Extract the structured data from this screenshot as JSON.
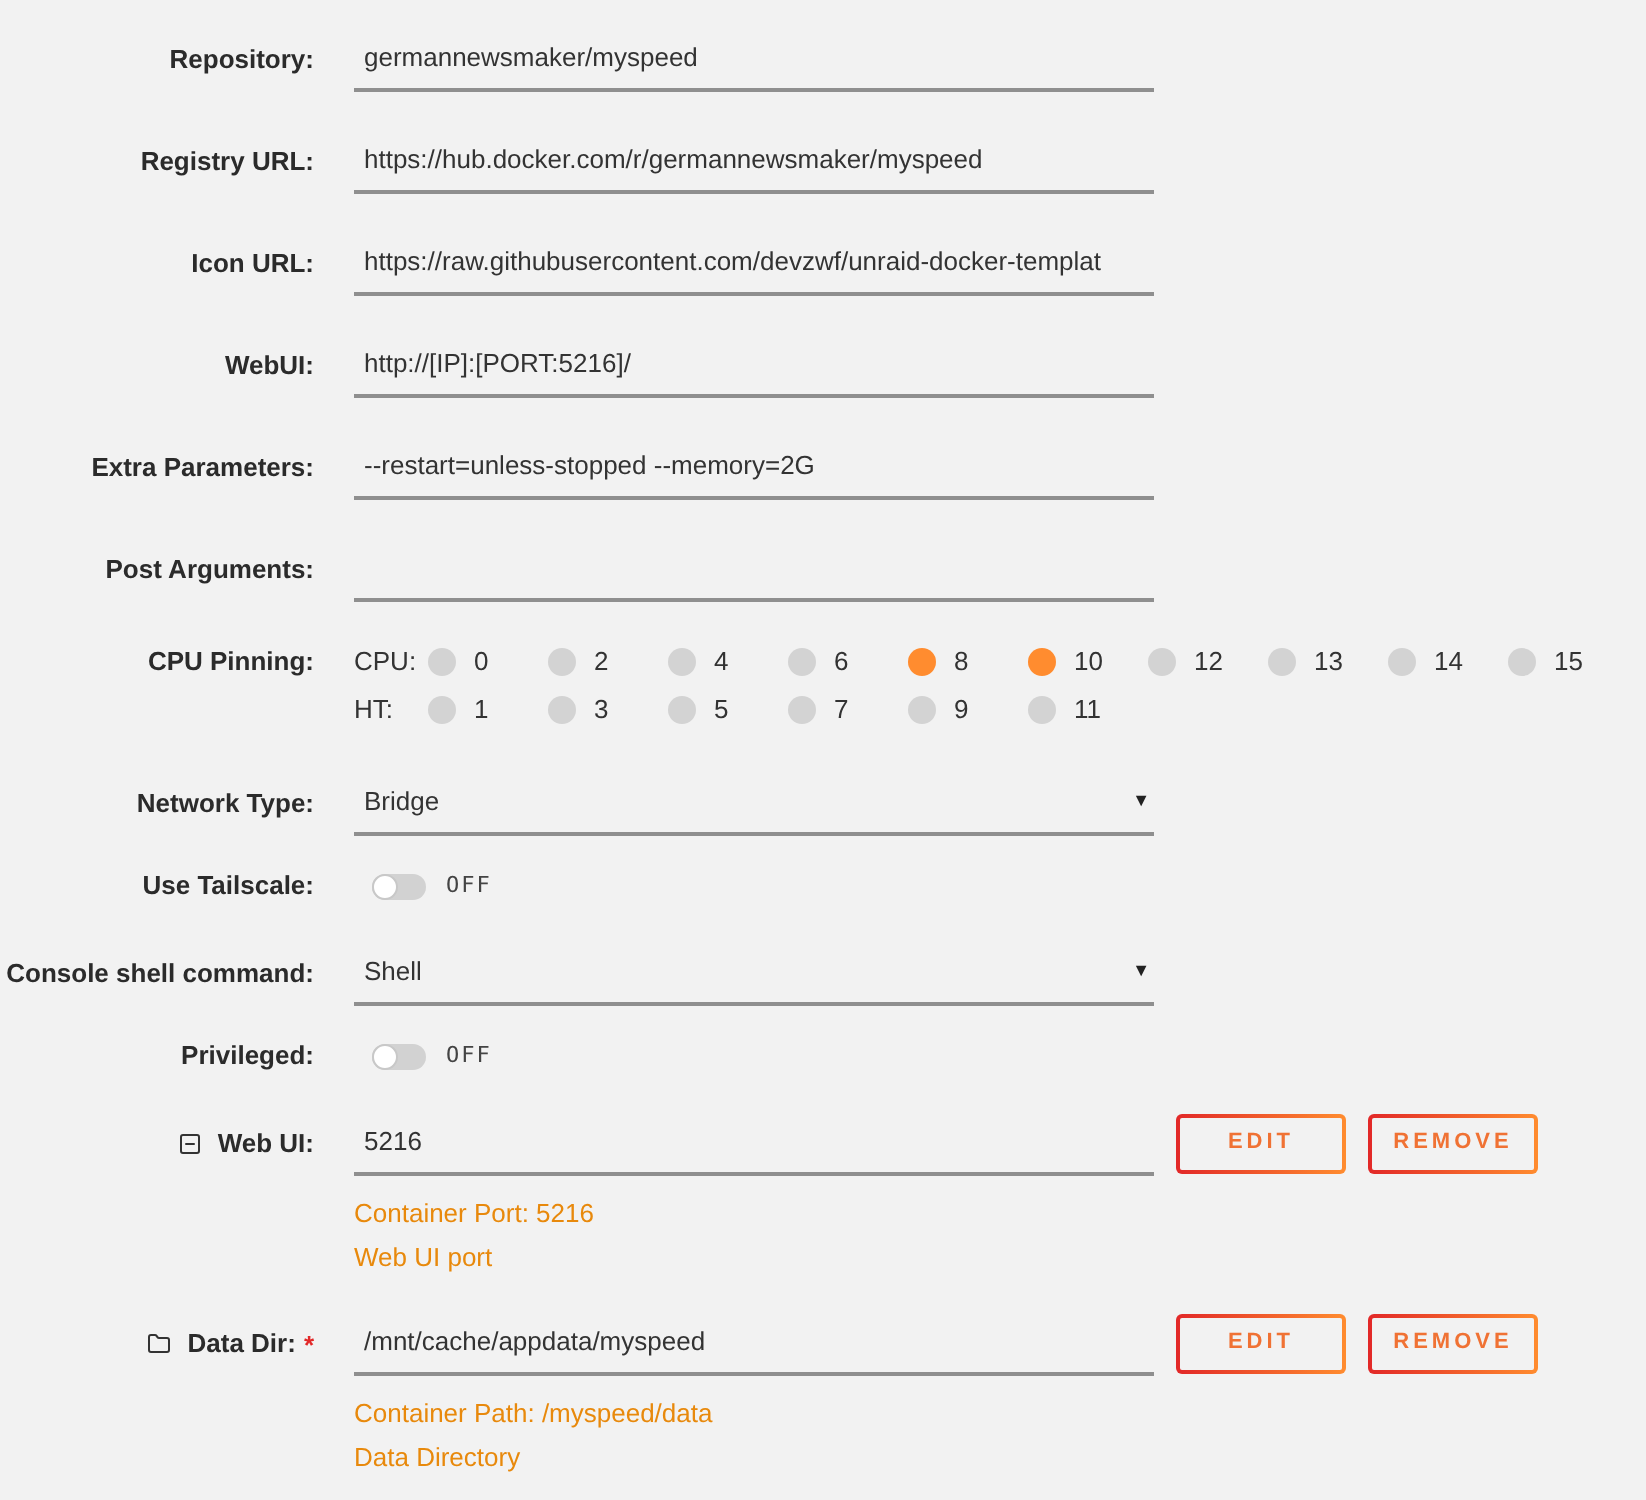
{
  "fields": [
    {
      "kind": "text",
      "label": "Repository:",
      "value": "germannewsmaker/myspeed"
    },
    {
      "kind": "text",
      "label": "Registry URL:",
      "value": "https://hub.docker.com/r/germannewsmaker/myspeed"
    },
    {
      "kind": "text",
      "label": "Icon URL:",
      "value": "https://raw.githubusercontent.com/devzwf/unraid-docker-templat"
    },
    {
      "kind": "text",
      "label": "WebUI:",
      "value": "http://[IP]:[PORT:5216]/"
    },
    {
      "kind": "text",
      "label": "Extra Parameters:",
      "value": "--restart=unless-stopped --memory=2G"
    },
    {
      "kind": "text",
      "label": "Post Arguments:"
    },
    {
      "kind": "cpu",
      "label": "CPU Pinning:",
      "rows": [
        {
          "label": "CPU:",
          "cores": [
            {
              "number": "0",
              "selected": false
            },
            {
              "number": "2",
              "selected": false
            },
            {
              "number": "4",
              "selected": false
            },
            {
              "number": "6",
              "selected": false
            },
            {
              "number": "8",
              "selected": true
            },
            {
              "number": "10",
              "selected": true
            },
            {
              "number": "12",
              "selected": false
            },
            {
              "number": "13",
              "selected": false
            },
            {
              "number": "14",
              "selected": false
            },
            {
              "number": "15",
              "selected": false
            }
          ]
        },
        {
          "label": "HT:",
          "cores": [
            {
              "number": "1",
              "selected": false
            },
            {
              "number": "3",
              "selected": false
            },
            {
              "number": "5",
              "selected": false
            },
            {
              "number": "7",
              "selected": false
            },
            {
              "number": "9",
              "selected": false
            },
            {
              "number": "11",
              "selected": false
            }
          ]
        }
      ]
    },
    {
      "kind": "select",
      "label": "Network Type:",
      "value": "Bridge",
      "caret": "▼"
    },
    {
      "kind": "toggle",
      "label": "Use Tailscale:",
      "on": false,
      "state_text": "OFF"
    },
    {
      "kind": "select",
      "label": "Console shell command:",
      "value": "Shell",
      "caret": "▼"
    },
    {
      "kind": "toggle",
      "label": "Privileged:",
      "on": false,
      "state_text": "OFF"
    }
  ],
  "config_items": [
    {
      "kind": "port",
      "label": "Web UI:",
      "value": "5216",
      "buttons": [
        "EDIT",
        "REMOVE"
      ],
      "details": [
        "Container Port: 5216",
        "Web UI port"
      ]
    },
    {
      "kind": "path",
      "label": "Data Dir:",
      "required_mark": "*",
      "value": "/mnt/cache/appdata/myspeed",
      "buttons": [
        "EDIT",
        "REMOVE"
      ],
      "details": [
        "Container Path: /myspeed/data",
        "Data Directory"
      ]
    }
  ]
}
